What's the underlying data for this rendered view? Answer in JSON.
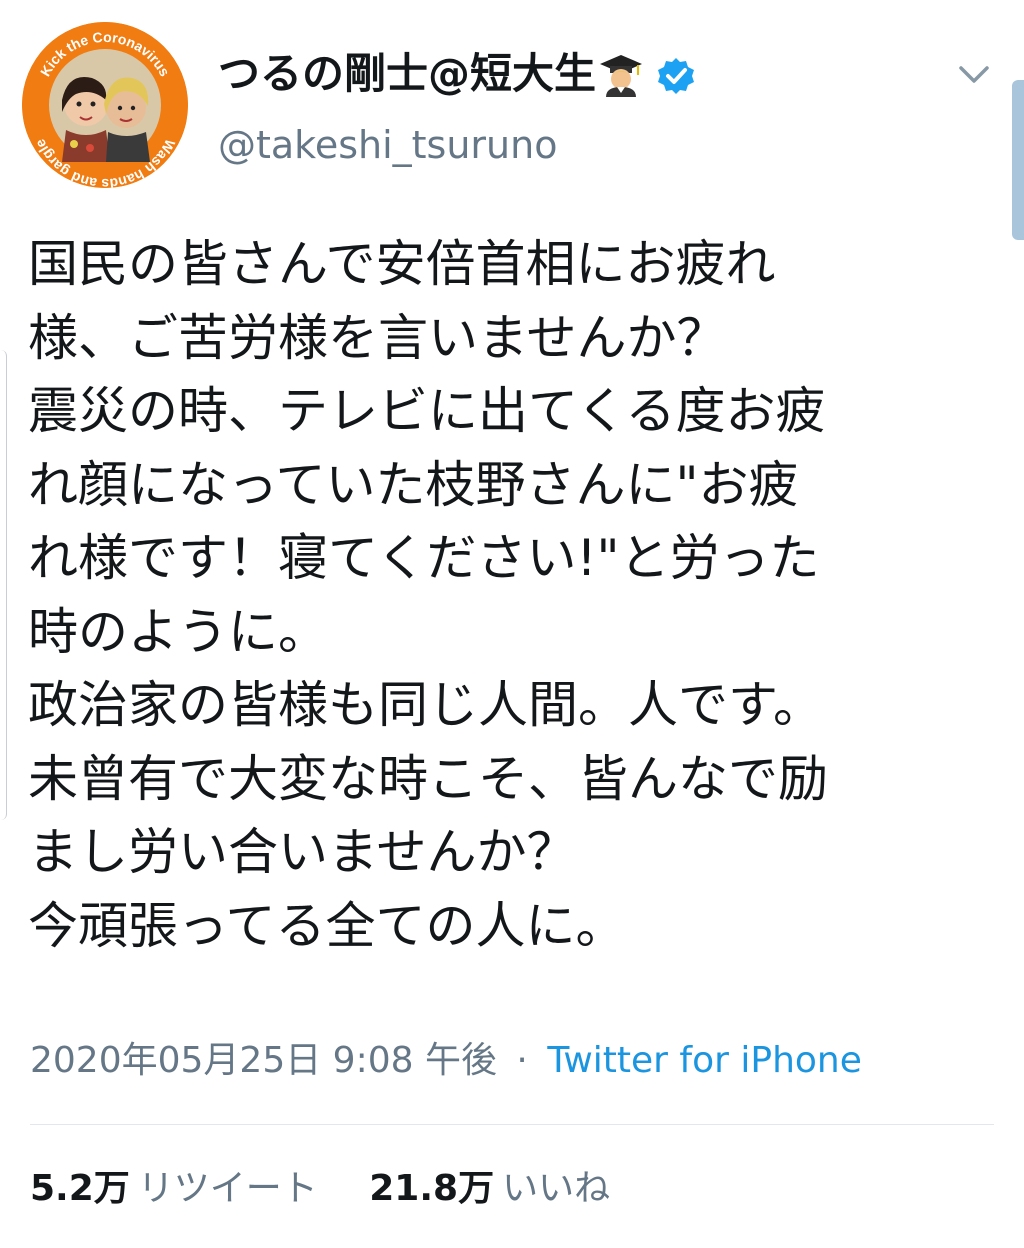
{
  "profile": {
    "display_name": "つるの剛士@短大生",
    "handle": "@takeshi_tsuruno",
    "avatar_ring_text": "Kick the Coronavirus Wash hands and gargle",
    "grad_emoji_icon": "man-student-icon",
    "verified_icon": "verified-badge-icon"
  },
  "tweet": {
    "lines": [
      "国民の皆さんで安倍首相にお疲れ",
      "様、ご苦労様を言いませんか？",
      "震災の時、テレビに出てくる度お疲",
      "れ顔になっていた枝野さんに\"お疲",
      "れ様です！寝てください!\"と労った",
      "時のように。",
      "政治家の皆様も同じ人間。人です。",
      "未曾有で大変な時こそ、皆んなで励",
      "まし労い合いませんか？",
      "今頑張ってる全ての人に。"
    ]
  },
  "meta": {
    "timestamp": "2020年05月25日 9:08 午後",
    "separator": "·",
    "source": "Twitter for iPhone"
  },
  "stats": {
    "retweets_count": "5.2万",
    "retweets_label": "リツイート",
    "likes_count": "21.8万",
    "likes_label": "いいね"
  },
  "colors": {
    "text": "#14171a",
    "secondary": "#657786",
    "link": "#1b95e0",
    "verified": "#1da1f2",
    "avatar_ring": "#f07c12"
  }
}
